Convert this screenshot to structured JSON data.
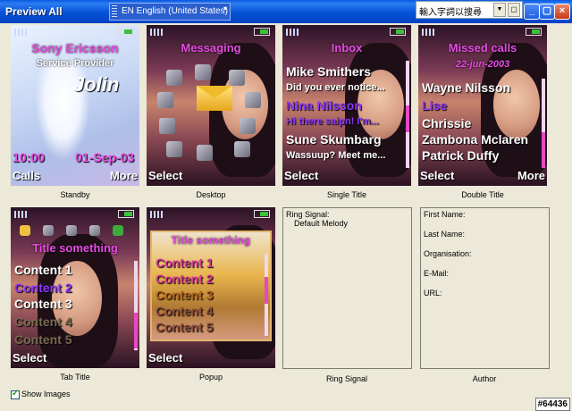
{
  "window": {
    "title": "Preview All",
    "language": "EN English (United States)",
    "ime_text": "輸入字詞以搜尋"
  },
  "previews": [
    {
      "caption": "Standby",
      "operator_line1": "Sony Ericsson",
      "operator_line2": "Service Provider",
      "logo_text": "Jolin",
      "time": "10:00",
      "date": "01-Sep-03",
      "left_soft": "Calls",
      "right_soft": "More"
    },
    {
      "caption": "Desktop",
      "title": "Messaging",
      "left_soft": "Select"
    },
    {
      "caption": "Single Title",
      "title": "Inbox",
      "items": [
        "Mike Smithers",
        "Did you ever notice...",
        "Nina Nilsson",
        "Hi there saipn! I'm...",
        "Sune Skumbarg",
        "Wassuup?  Meet me..."
      ],
      "left_soft": "Select"
    },
    {
      "caption": "Double Title",
      "title": "Missed calls",
      "subtitle": "22-jun-2003",
      "items": [
        "Wayne Nilsson",
        "Lise",
        "Chrissie",
        "Zambona Mclaren",
        "Patrick Duffy"
      ],
      "left_soft": "Select",
      "right_soft": "More"
    },
    {
      "caption": "Tab Title",
      "title": "Title something",
      "items": [
        "Content 1",
        "Content 2",
        "Content 3",
        "Content 4",
        "Content 5"
      ],
      "left_soft": "Select"
    },
    {
      "caption": "Popup",
      "title": "Title something",
      "items": [
        "Content 1",
        "Content 2",
        "Content 3",
        "Content 4",
        "Content 5"
      ],
      "left_soft": "Select"
    },
    {
      "caption": "Ring Signal",
      "label": "Ring Signal:",
      "value": "Default Melody"
    },
    {
      "caption": "Author",
      "fields": [
        "First Name:",
        "Last Name:",
        "Organisation:",
        "E-Mail:",
        "URL:"
      ]
    }
  ],
  "footer": {
    "show_images_label": "Show Images",
    "watermark": "#64436"
  }
}
